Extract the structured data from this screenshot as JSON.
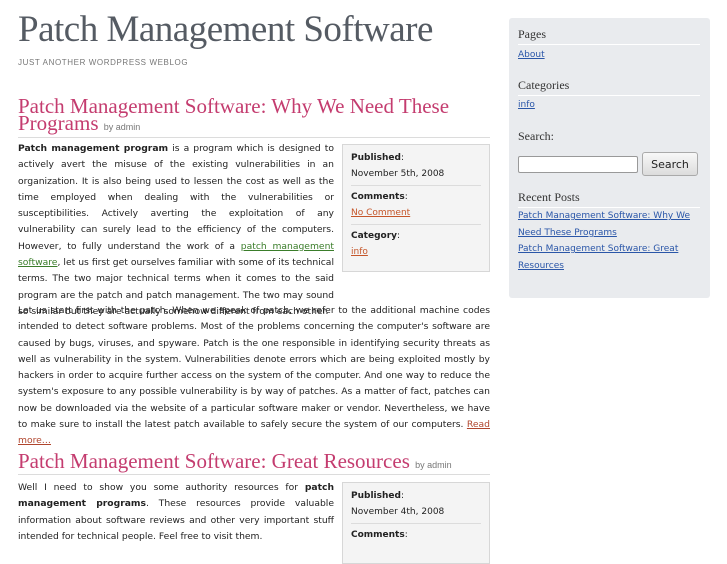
{
  "site": {
    "title": "Patch Management Software",
    "description": "JUST ANOTHER WORDPRESS WEBLOG"
  },
  "post1": {
    "title": "Patch Management Software: Why We Need These Programs",
    "byline": "by admin",
    "p1_bold": "Patch management program",
    "p1_a": " is a program which is designed to actively avert the misuse of the existing vulnerabilities in an organization. It is also being used to lessen the cost as well as the time employed when dealing with the vulnerabilities or susceptibilities. Actively averting the exploitation of any vulnerability can surely lead to the efficiency of the computers. However, to fully understand the work of a ",
    "p1_link": "patch management software",
    "p1_b": ", let us first get ourselves familiar with some of its technical terms. The two major technical terms when it comes to the said program are the patch and patch management. The two may sound so similar but they are actually somehow different from each other.",
    "p2": "Let us start first with the patch. When we speak of patch, we refer to the additional machine codes intended to detect software problems. Most of the problems concerning the computer's software are caused by bugs, viruses, and spyware. Patch is the one responsible in identifying security threats as well as vulnerability in the system. Vulnerabilities denote errors which are being exploited mostly by hackers in order to acquire further access on the system of the computer. And one way to reduce the system's exposure to any possible vulnerability is by way of patches. As a matter of fact, patches can now be downloaded via the website of a particular software maker or vendor. Nevertheless, we have to make sure to install the latest patch available to safely secure the system of our computers. ",
    "read_more": "Read more…",
    "meta": {
      "published_label": "Published",
      "published_date": "November 5th, 2008",
      "comments_label": "Comments",
      "comments_value": "No Comment",
      "category_label": "Category",
      "category_value": "info"
    }
  },
  "post2": {
    "title": "Patch Management Software: Great Resources",
    "byline": "by admin",
    "p1_a": "Well I need to show you some authority resources for ",
    "p1_bold": "patch management programs",
    "p1_b": ". These resources provide valuable information about software reviews and other very important stuff intended for technical people. Feel free to visit them.",
    "meta": {
      "published_label": "Published",
      "published_date": "November 4th, 2008",
      "comments_label": "Comments"
    }
  },
  "sidebar": {
    "pages_heading": "Pages",
    "pages": [
      "About"
    ],
    "categories_heading": "Categories",
    "categories": [
      "info"
    ],
    "search_heading": "Search:",
    "search_button": "Search",
    "search_value": "",
    "recent_heading": "Recent Posts",
    "recent": [
      "Patch Management Software: Why We Need These Programs",
      "Patch Management Software: Great Resources"
    ]
  }
}
